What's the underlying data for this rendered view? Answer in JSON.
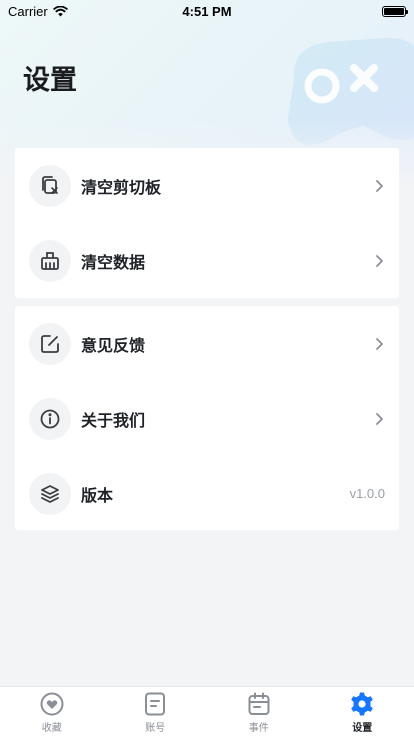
{
  "status_bar": {
    "carrier": "Carrier",
    "time": "4:51 PM"
  },
  "page": {
    "title": "设置"
  },
  "settings_groups": [
    {
      "items": [
        {
          "label": "清空剪切板",
          "icon": "clipboard-clear-icon"
        },
        {
          "label": "清空数据",
          "icon": "data-clear-icon"
        }
      ]
    },
    {
      "items": [
        {
          "label": "意见反馈",
          "icon": "feedback-edit-icon"
        },
        {
          "label": "关于我们",
          "icon": "info-icon"
        },
        {
          "label": "版本",
          "icon": "layers-icon",
          "value": "v1.0.0"
        }
      ]
    }
  ],
  "tabbar": {
    "tabs": [
      {
        "label": "收藏",
        "icon": "heart-icon"
      },
      {
        "label": "账号",
        "icon": "account-note-icon"
      },
      {
        "label": "事件",
        "icon": "calendar-icon"
      },
      {
        "label": "设置",
        "icon": "gear-icon"
      }
    ],
    "active_index": 3
  },
  "colors": {
    "accent": "#1677ff",
    "icon": "#3a3d42",
    "muted": "#9aa0a6"
  }
}
